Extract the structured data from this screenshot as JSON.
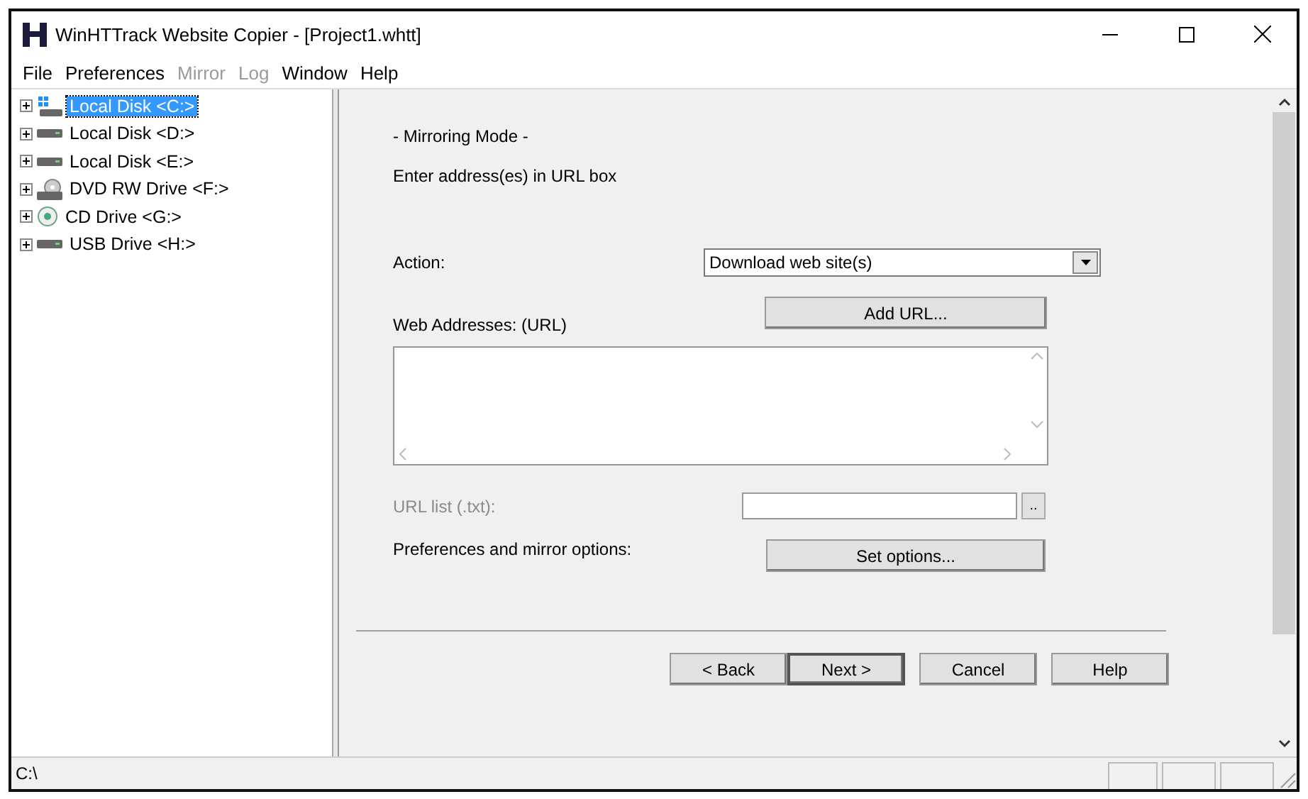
{
  "window": {
    "title": "WinHTTrack Website Copier - [Project1.whtt]"
  },
  "menu": [
    {
      "label": "File",
      "disabled": false
    },
    {
      "label": "Preferences",
      "disabled": false
    },
    {
      "label": "Mirror",
      "disabled": true
    },
    {
      "label": "Log",
      "disabled": true
    },
    {
      "label": "Window",
      "disabled": false
    },
    {
      "label": "Help",
      "disabled": false
    }
  ],
  "drives": [
    {
      "label": "Local Disk <C:>",
      "kind": "system-disk",
      "selected": true
    },
    {
      "label": "Local Disk <D:>",
      "kind": "disk",
      "selected": false
    },
    {
      "label": "Local Disk <E:>",
      "kind": "disk",
      "selected": false
    },
    {
      "label": "DVD RW Drive <F:>",
      "kind": "dvd",
      "selected": false
    },
    {
      "label": "CD Drive <G:>",
      "kind": "cd",
      "selected": false
    },
    {
      "label": "USB Drive <H:>",
      "kind": "disk",
      "selected": false
    }
  ],
  "wizard": {
    "mode": "- Mirroring Mode -",
    "instruction": "Enter address(es) in URL box",
    "action_label": "Action:",
    "action_value": "Download web site(s)",
    "urls_label": "Web Addresses: (URL)",
    "add_url": "Add URL...",
    "url_list_label": "URL list (.txt):",
    "url_list_disabled": true,
    "browse": "..",
    "options_label": "Preferences and mirror options:",
    "set_options": "Set options..."
  },
  "nav_buttons": [
    {
      "label": "< Back",
      "default": false
    },
    {
      "label": "Next >",
      "default": true
    },
    {
      "label": "Cancel",
      "default": false
    },
    {
      "label": "Help",
      "default": false
    }
  ],
  "status_bar": {
    "path": "C:\\"
  }
}
